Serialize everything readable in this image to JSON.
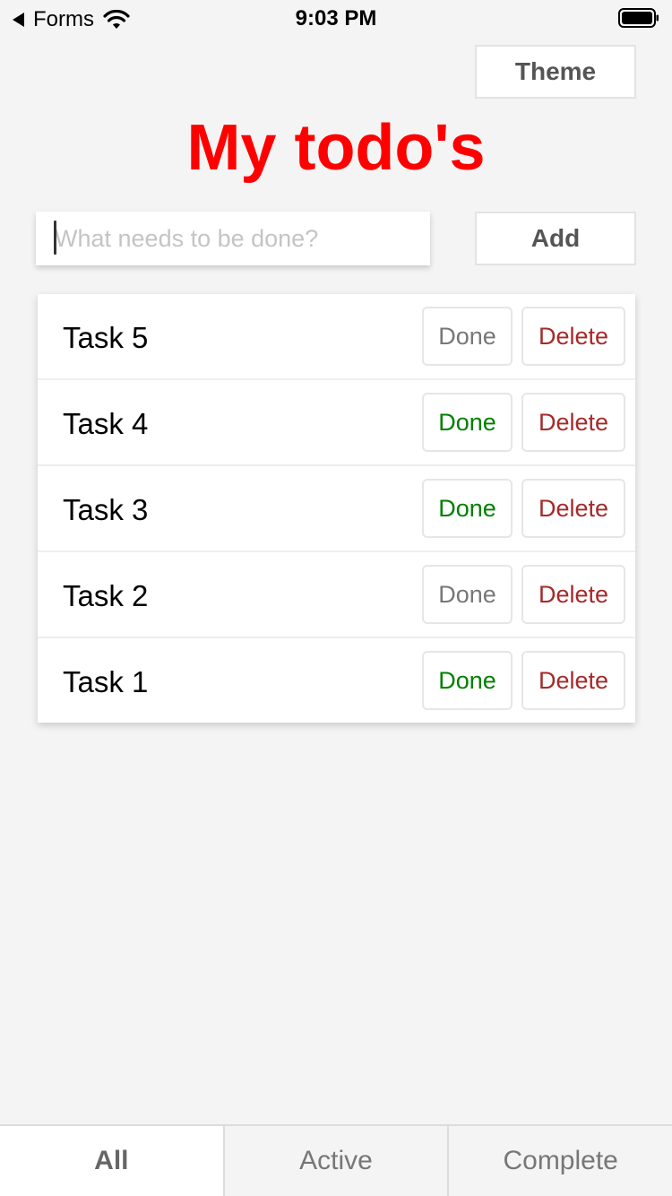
{
  "status_bar": {
    "back_label": "Forms",
    "time": "9:03 PM",
    "icons": [
      "back-arrow-icon",
      "wifi-icon",
      "battery-icon"
    ]
  },
  "header": {
    "theme_label": "Theme",
    "title": "My todo's",
    "title_color": "#ff0000"
  },
  "new_todo": {
    "placeholder": "What needs to be done?",
    "value": "",
    "add_label": "Add"
  },
  "tasks": [
    {
      "label": "Task 5",
      "done_label": "Done",
      "delete_label": "Delete",
      "done_color": "#777777"
    },
    {
      "label": "Task 4",
      "done_label": "Done",
      "delete_label": "Delete",
      "done_color": "#008000"
    },
    {
      "label": "Task 3",
      "done_label": "Done",
      "delete_label": "Delete",
      "done_color": "#008000"
    },
    {
      "label": "Task 2",
      "done_label": "Done",
      "delete_label": "Delete",
      "done_color": "#777777"
    },
    {
      "label": "Task 1",
      "done_label": "Done",
      "delete_label": "Delete",
      "done_color": "#008000"
    }
  ],
  "delete_color": "#a52a2a",
  "tabs": [
    {
      "label": "All",
      "selected": true
    },
    {
      "label": "Active",
      "selected": false
    },
    {
      "label": "Complete",
      "selected": false
    }
  ]
}
